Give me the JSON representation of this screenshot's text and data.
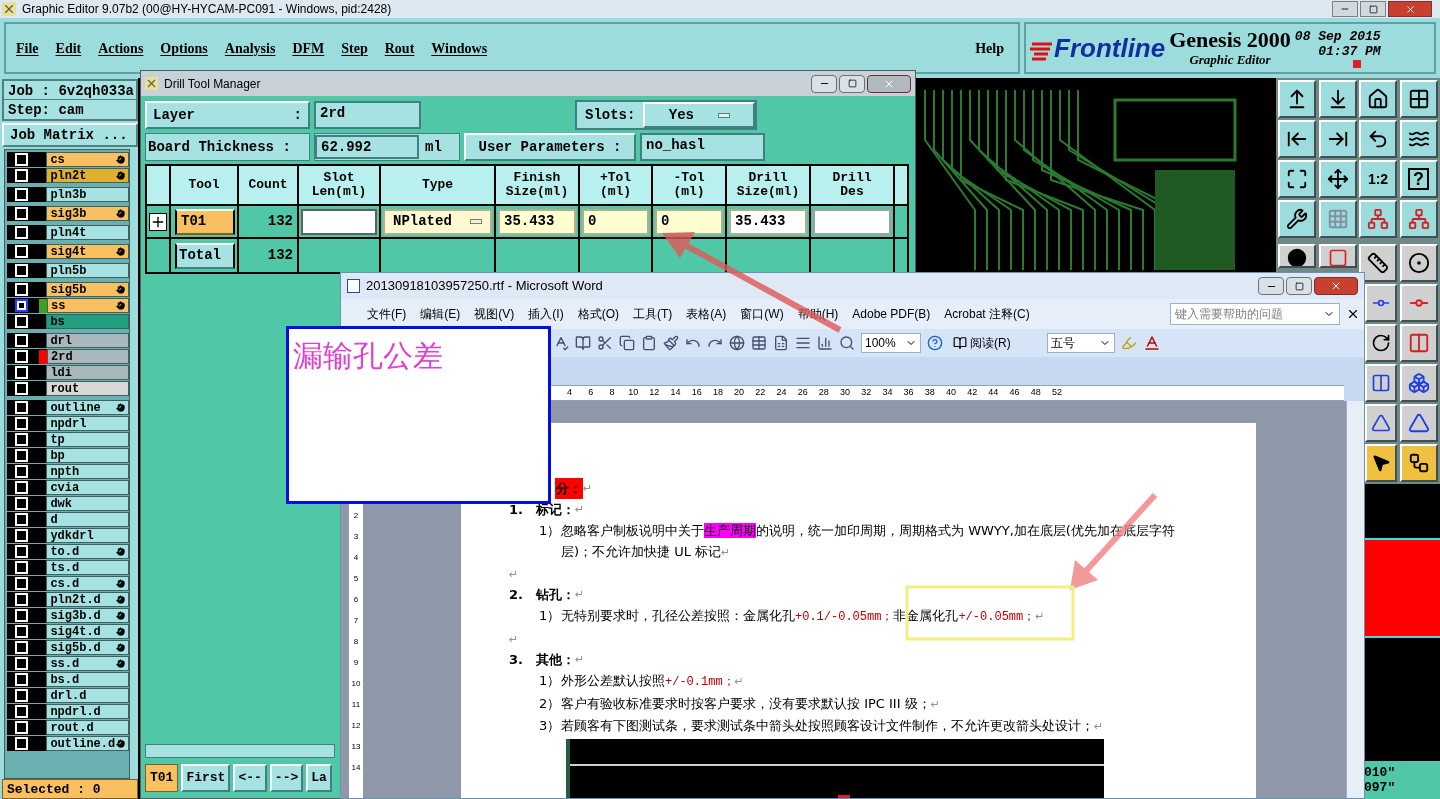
{
  "window": {
    "title": "Graphic Editor 9.07b2 (00@HY-HYCAM-PC091 - Windows, pid:2428)"
  },
  "menu": [
    "File",
    "Edit",
    "Actions",
    "Options",
    "Analysis",
    "DFM",
    "Step",
    "Rout",
    "Windows"
  ],
  "help_menu": "Help",
  "brand": {
    "logo": "Frontline",
    "product": "Genesis 2000",
    "subtitle": "Graphic Editor",
    "date": "08 Sep 2015",
    "time": "01:37 PM"
  },
  "job_panel": {
    "job": "Job : 6v2qh033a",
    "step": "Step: cam",
    "matrix_button": "Job Matrix ..."
  },
  "layer_groups": [
    [
      {
        "name": "cs",
        "color": "#f8c060",
        "marked": true,
        "selected": false,
        "work": false,
        "affected": false
      },
      {
        "name": "pln2t",
        "color": "#e0b030",
        "marked": true,
        "selected": false,
        "work": false,
        "affected": false
      }
    ],
    [
      {
        "name": "pln3b",
        "color": "#a6e2e2",
        "marked": false,
        "selected": false,
        "work": false,
        "affected": false
      }
    ],
    [
      {
        "name": "sig3b",
        "color": "#f8c060",
        "marked": true,
        "selected": false,
        "work": false,
        "affected": false
      }
    ],
    [
      {
        "name": "pln4t",
        "color": "#a6e2e2",
        "marked": false,
        "selected": false,
        "work": false,
        "affected": false
      }
    ],
    [
      {
        "name": "sig4t",
        "color": "#f8c060",
        "marked": true,
        "selected": false,
        "work": false,
        "affected": false
      }
    ],
    [
      {
        "name": "pln5b",
        "color": "#a6e2e2",
        "marked": false,
        "selected": false,
        "work": false,
        "affected": false
      }
    ],
    [
      {
        "name": "sig5b",
        "color": "#f8c060",
        "marked": true,
        "selected": false,
        "work": false,
        "affected": false
      },
      {
        "name": "ss",
        "color": "#f8c060",
        "marked": true,
        "selected": true,
        "work": false,
        "affected": true
      },
      {
        "name": "bs",
        "color": "#20a080",
        "marked": false,
        "selected": false,
        "work": false,
        "affected": false
      }
    ],
    [
      {
        "name": "drl",
        "color": "#a8b8bc",
        "marked": false,
        "selected": false,
        "work": false,
        "affected": false
      },
      {
        "name": "2rd",
        "color": "#a8b8bc",
        "marked": false,
        "selected": false,
        "work": true,
        "affected": false
      },
      {
        "name": "ldi",
        "color": "#a8b8bc",
        "marked": false,
        "selected": false,
        "work": false,
        "affected": false
      },
      {
        "name": "rout",
        "color": "#d8d8d8",
        "marked": false,
        "selected": false,
        "work": false,
        "affected": false
      }
    ],
    [
      {
        "name": "outline",
        "color": "#a6e2e2",
        "marked": true,
        "selected": false,
        "work": false,
        "affected": false
      },
      {
        "name": "npdrl",
        "color": "#a6e2e2",
        "marked": false,
        "selected": false,
        "work": false,
        "affected": false
      },
      {
        "name": "tp",
        "color": "#a6e2e2",
        "marked": false,
        "selected": false,
        "work": false,
        "affected": false
      },
      {
        "name": "bp",
        "color": "#a6e2e2",
        "marked": false,
        "selected": false,
        "work": false,
        "affected": false
      },
      {
        "name": "npth",
        "color": "#a6e2e2",
        "marked": false,
        "selected": false,
        "work": false,
        "affected": false
      },
      {
        "name": "cvia",
        "color": "#a6e2e2",
        "marked": false,
        "selected": false,
        "work": false,
        "affected": false
      },
      {
        "name": "dwk",
        "color": "#a6e2e2",
        "marked": false,
        "selected": false,
        "work": false,
        "affected": false
      },
      {
        "name": "d",
        "color": "#a6e2e2",
        "marked": false,
        "selected": false,
        "work": false,
        "affected": false
      },
      {
        "name": "ydkdrl",
        "color": "#a6e2e2",
        "marked": false,
        "selected": false,
        "work": false,
        "affected": false
      },
      {
        "name": "to.d",
        "color": "#a6e2e2",
        "marked": true,
        "selected": false,
        "work": false,
        "affected": false
      },
      {
        "name": "ts.d",
        "color": "#a6e2e2",
        "marked": false,
        "selected": false,
        "work": false,
        "affected": false
      },
      {
        "name": "cs.d",
        "color": "#a6e2e2",
        "marked": true,
        "selected": false,
        "work": false,
        "affected": false
      },
      {
        "name": "pln2t.d",
        "color": "#a6e2e2",
        "marked": true,
        "selected": false,
        "work": false,
        "affected": false
      },
      {
        "name": "sig3b.d",
        "color": "#a6e2e2",
        "marked": true,
        "selected": false,
        "work": false,
        "affected": false
      },
      {
        "name": "sig4t.d",
        "color": "#a6e2e2",
        "marked": true,
        "selected": false,
        "work": false,
        "affected": false
      },
      {
        "name": "sig5b.d",
        "color": "#a6e2e2",
        "marked": true,
        "selected": false,
        "work": false,
        "affected": false
      },
      {
        "name": "ss.d",
        "color": "#a6e2e2",
        "marked": true,
        "selected": false,
        "work": false,
        "affected": false
      },
      {
        "name": "bs.d",
        "color": "#a6e2e2",
        "marked": false,
        "selected": false,
        "work": false,
        "affected": false
      },
      {
        "name": "drl.d",
        "color": "#a6e2e2",
        "marked": false,
        "selected": false,
        "work": false,
        "affected": false
      },
      {
        "name": "npdrl.d",
        "color": "#a6e2e2",
        "marked": false,
        "selected": false,
        "work": false,
        "affected": false
      },
      {
        "name": "rout.d",
        "color": "#a6e2e2",
        "marked": false,
        "selected": false,
        "work": false,
        "affected": false
      },
      {
        "name": "outline.d",
        "color": "#a6e2e2",
        "marked": true,
        "selected": false,
        "work": false,
        "affected": false
      }
    ]
  ],
  "selected_status": "Selected : 0",
  "toolbar": {
    "scale_label": "1:2",
    "help_label": "?"
  },
  "coordinates": [
    "010\"",
    "097\""
  ],
  "drill_tool_manager": {
    "title": "Drill Tool Manager",
    "layer": {
      "label": "Layer",
      "colon": ":",
      "value": "2rd"
    },
    "slots": {
      "label": "Slots:",
      "value": "Yes"
    },
    "thickness": {
      "label": "Board Thickness :",
      "value": "62.992",
      "unit": "ml"
    },
    "user_parameters": {
      "label": "User Parameters :",
      "value": "no_hasl"
    },
    "columns": [
      "Tool",
      "Count",
      "Slot\nLen(ml)",
      "Type",
      "Finish\nSize(ml)",
      "+Tol\n(ml)",
      "-Tol\n(ml)",
      "Drill\nSize(ml)",
      "Drill\nDes"
    ],
    "rows": [
      {
        "tool": "T01",
        "count": "132",
        "type": "NPlated",
        "finish": "35.433",
        "plus_tol": "0",
        "minus_tol": "0",
        "drill_size": "35.433"
      }
    ],
    "total": {
      "label": "Total",
      "count": "132"
    },
    "nav": {
      "current": "T01",
      "buttons": [
        "First",
        "<--",
        "-->",
        "La"
      ]
    }
  },
  "callout": {
    "text": "漏输孔公差"
  },
  "word": {
    "title": "20130918103957250.rtf - Microsoft Word",
    "menu": [
      "文件(F)",
      "编辑(E)",
      "视图(V)",
      "插入(I)",
      "格式(O)",
      "工具(T)",
      "表格(A)",
      "窗口(W)",
      "帮助(H)",
      "Adobe PDF(B)",
      "Acrobat 注释(C)"
    ],
    "help_placeholder": "键入需要帮助的问题",
    "zoom": "100%",
    "read_button": "阅读(R)",
    "font_size": "五号",
    "ruler": [
      "4",
      "6",
      "8",
      "10",
      "12",
      "14",
      "16",
      "18",
      "20",
      "22",
      "24",
      "26",
      "28",
      "30",
      "32",
      "34",
      "36",
      "38",
      "40",
      "42",
      "44",
      "46",
      "48",
      "52"
    ],
    "vruler": [
      "2",
      "3",
      "4",
      "5",
      "6",
      "7",
      "8",
      "9",
      "10",
      "11",
      "12",
      "13",
      "14"
    ],
    "heading": {
      "text": "分：",
      "end": "↵"
    },
    "paragraphs": [
      {
        "kind": "section",
        "number": "1.",
        "text": "标记：",
        "end": "↵"
      },
      {
        "kind": "item",
        "number": "1）",
        "parts": [
          {
            "text": "忽略客户制板说明中关于",
            "kind": "plain"
          },
          {
            "text": "生产周期",
            "kind": "highlight"
          },
          {
            "text": "的说明，统一加印周期，周期格式为 WWYY,加在底层(优先加在底层字符层)；不允许加快捷 UL 标记",
            "kind": "plain"
          }
        ],
        "end": "↵"
      },
      {
        "kind": "blank",
        "end": "↵"
      },
      {
        "kind": "section",
        "number": "2.",
        "text": "钻孔：",
        "end": "↵"
      },
      {
        "kind": "item",
        "number": "1）",
        "parts": [
          {
            "text": "无特别要求时，孔径公差按照：金属化孔",
            "kind": "plain"
          },
          {
            "text": "+0.1/-0.05mm；",
            "kind": "red"
          },
          {
            "text": "非金属化孔",
            "kind": "plain"
          },
          {
            "text": "+/-0.05mm；",
            "kind": "red"
          }
        ],
        "end": "↵"
      },
      {
        "kind": "blank",
        "end": "↵"
      },
      {
        "kind": "section",
        "number": "3.",
        "text": "其他：",
        "end": "↵"
      },
      {
        "kind": "item",
        "number": "1）",
        "parts": [
          {
            "text": "外形公差默认按照",
            "kind": "plain"
          },
          {
            "text": "+/-0.1mm；",
            "kind": "red"
          }
        ],
        "end": "↵"
      },
      {
        "kind": "item",
        "number": "2）",
        "parts": [
          {
            "text": "客户有验收标准要求时按客户要求，没有要求默认按 IPC III 级；",
            "kind": "plain"
          }
        ],
        "end": "↵"
      },
      {
        "kind": "item",
        "number": "3）",
        "parts": [
          {
            "text": "若顾客有下图测试条，要求测试条中箭头处按照顾客设计文件制作，不允许更改箭头处设计；",
            "kind": "plain"
          }
        ],
        "end": "↵"
      }
    ]
  }
}
